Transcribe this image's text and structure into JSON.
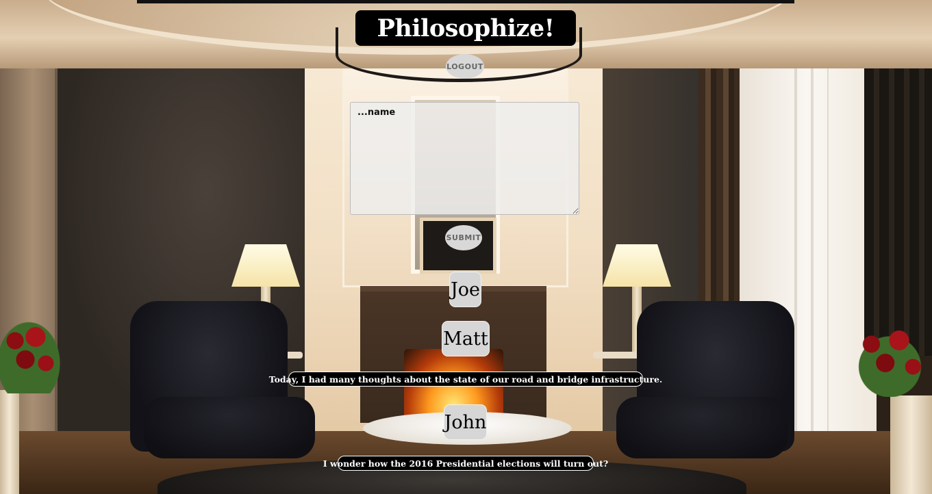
{
  "header": {
    "title": "Philosophize!",
    "logout_label": "LOGOUT"
  },
  "form": {
    "name_placeholder": "...name",
    "submit_label": "SUBMIT"
  },
  "posts": [
    {
      "author": "Joe",
      "thought": ""
    },
    {
      "author": "Matt",
      "thought": "Today, I had many thoughts about the state of our road and bridge infrastructure."
    },
    {
      "author": "John",
      "thought": "I wonder how the 2016 Presidential elections will turn out?"
    }
  ]
}
